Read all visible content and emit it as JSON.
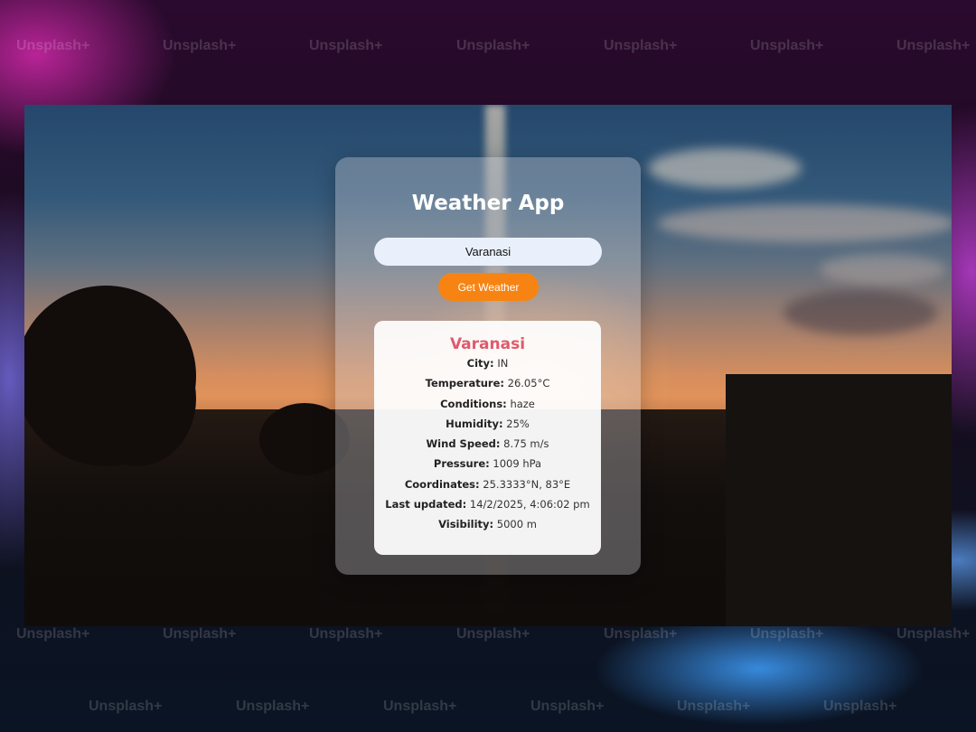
{
  "watermark": "Unsplash+",
  "app": {
    "title": "Weather App",
    "input_value": "Varanasi",
    "button_label": "Get Weather"
  },
  "result": {
    "city_name": "Varanasi",
    "rows": [
      {
        "label": "City:",
        "value": "IN"
      },
      {
        "label": "Temperature:",
        "value": "26.05°C"
      },
      {
        "label": "Conditions:",
        "value": "haze"
      },
      {
        "label": "Humidity:",
        "value": "25%"
      },
      {
        "label": "Wind Speed:",
        "value": "8.75 m/s"
      },
      {
        "label": "Pressure:",
        "value": "1009 hPa"
      },
      {
        "label": "Coordinates:",
        "value": "25.3333°N, 83°E"
      },
      {
        "label": "Last updated:",
        "value": "14/2/2025, 4:06:02 pm"
      },
      {
        "label": "Visibility:",
        "value": "5000 m"
      }
    ]
  },
  "colors": {
    "accent_button": "#f78412",
    "city_title": "#e05a6c"
  }
}
